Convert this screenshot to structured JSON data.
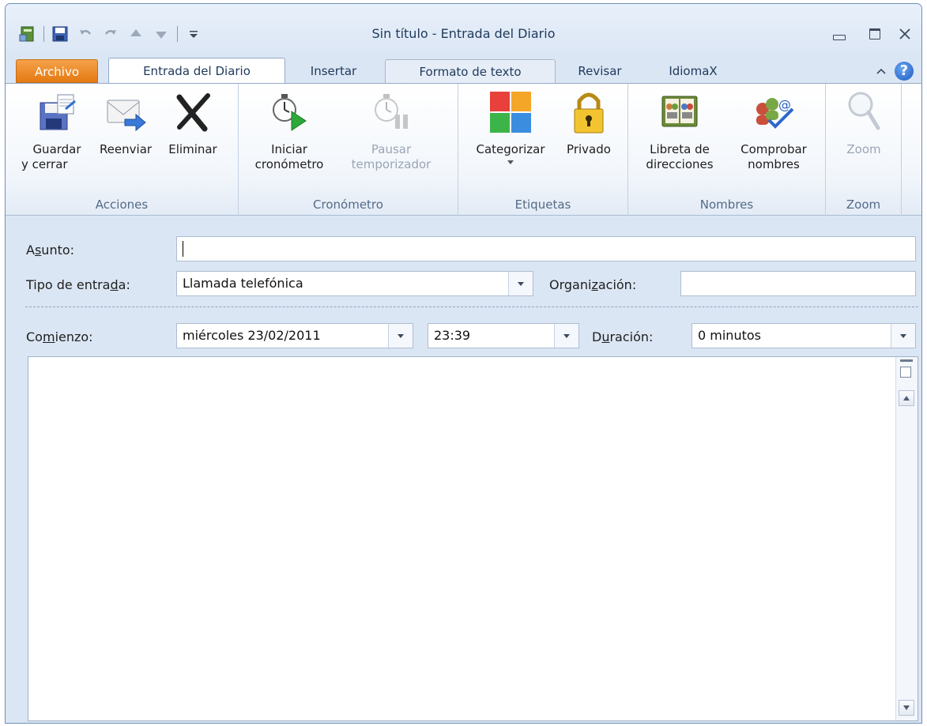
{
  "window": {
    "title": "Sin título  -  Entrada del Diario"
  },
  "tabs": [
    {
      "label": "Archivo"
    },
    {
      "label": "Entrada del Diario"
    },
    {
      "label": "Insertar"
    },
    {
      "label": "Formato de texto"
    },
    {
      "label": "Revisar"
    },
    {
      "label": "IdiomaX"
    }
  ],
  "ribbon": {
    "groups": [
      {
        "label": "Acciones",
        "buttons": [
          {
            "line1": "Guardar",
            "line2": "y cerrar",
            "icon": "save-close-icon"
          },
          {
            "line1": "Reenviar",
            "line2": "",
            "icon": "forward-icon"
          },
          {
            "line1": "Eliminar",
            "line2": "",
            "icon": "delete-icon"
          }
        ]
      },
      {
        "label": "Cronómetro",
        "buttons": [
          {
            "line1": "Iniciar",
            "line2": "cronómetro",
            "icon": "start-timer-icon"
          },
          {
            "line1": "Pausar",
            "line2": "temporizador",
            "icon": "pause-timer-icon"
          }
        ]
      },
      {
        "label": "Etiquetas",
        "buttons": [
          {
            "line1": "Categorizar",
            "line2": "",
            "icon": "categorize-icon"
          },
          {
            "line1": "Privado",
            "line2": "",
            "icon": "lock-icon"
          }
        ]
      },
      {
        "label": "Nombres",
        "buttons": [
          {
            "line1": "Libreta de",
            "line2": "direcciones",
            "icon": "address-book-icon"
          },
          {
            "line1": "Comprobar",
            "line2": "nombres",
            "icon": "check-names-icon"
          }
        ]
      },
      {
        "label": "Zoom",
        "buttons": [
          {
            "line1": "Zoom",
            "line2": "",
            "icon": "zoom-icon"
          }
        ]
      }
    ]
  },
  "form": {
    "subject": {
      "label_pre": "A",
      "label_u": "s",
      "label_post": "unto:",
      "value": ""
    },
    "entry_type": {
      "label_pre": "Tipo de entra",
      "label_u": "d",
      "label_post": "a:",
      "value": "Llamada telefónica"
    },
    "company": {
      "label_pre": "Organi",
      "label_u": "z",
      "label_post": "ación:",
      "value": ""
    },
    "start": {
      "label_pre": "Co",
      "label_u": "m",
      "label_post": "ienzo:",
      "date": "miércoles 23/02/2011",
      "time": "23:39"
    },
    "duration": {
      "label_pre": "D",
      "label_u": "u",
      "label_post": "ración:",
      "value": "0 minutos"
    }
  },
  "colors": {
    "file_tab": "#e47a12",
    "window_bg": "#dbe6f4",
    "accent": "#1e395b"
  }
}
